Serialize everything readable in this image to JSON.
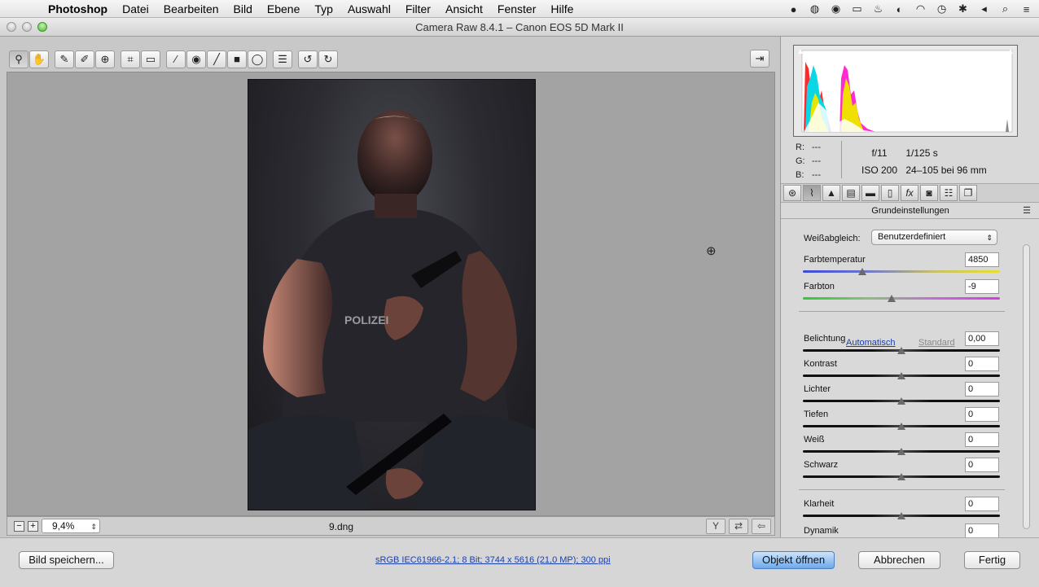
{
  "menubar": {
    "items": [
      "Photoshop",
      "Datei",
      "Bearbeiten",
      "Bild",
      "Ebene",
      "Typ",
      "Auswahl",
      "Filter",
      "Ansicht",
      "Fenster",
      "Hilfe"
    ]
  },
  "window": {
    "title": "Camera Raw 8.4.1 – Canon EOS 5D Mark II"
  },
  "toolbar": {
    "tools": [
      "zoom-icon",
      "hand-icon",
      "white-balance-icon",
      "color-sampler-icon",
      "target-adjust-icon",
      "crop-icon",
      "straighten-icon",
      "spot-removal-icon",
      "red-eye-icon",
      "adjustment-brush-icon",
      "graduated-filter-icon",
      "radial-filter-icon",
      "preferences-icon",
      "rotate-left-icon",
      "rotate-right-icon"
    ]
  },
  "status": {
    "zoom": "9,4%",
    "filename": "9.dng",
    "photo_caption": "POLIZEI"
  },
  "readout": {
    "r_label": "R:",
    "g_label": "G:",
    "b_label": "B:",
    "r_value": "---",
    "g_value": "---",
    "b_value": "---",
    "aperture": "f/11",
    "shutter": "1/125 s",
    "iso": "ISO 200",
    "lens": "24–105 bei 96 mm"
  },
  "panel": {
    "title": "Grundeinstellungen",
    "wb_label": "Weißabgleich:",
    "wb_value": "Benutzerdefiniert",
    "auto_label": "Automatisch",
    "default_label": "Standard",
    "sliders": [
      {
        "label": "Farbtemperatur",
        "value": "4850",
        "position": 0.3
      },
      {
        "label": "Farbton",
        "value": "-9",
        "position": 0.45
      },
      {
        "label": "Belichtung",
        "value": "0,00",
        "position": 0.5
      },
      {
        "label": "Kontrast",
        "value": "0",
        "position": 0.5
      },
      {
        "label": "Lichter",
        "value": "0",
        "position": 0.5
      },
      {
        "label": "Tiefen",
        "value": "0",
        "position": 0.5
      },
      {
        "label": "Weiß",
        "value": "0",
        "position": 0.5
      },
      {
        "label": "Schwarz",
        "value": "0",
        "position": 0.5
      },
      {
        "label": "Klarheit",
        "value": "0",
        "position": 0.5
      },
      {
        "label": "Dynamik",
        "value": "0",
        "position": 0.5
      }
    ]
  },
  "footer": {
    "save_label": "Bild speichern...",
    "file_info": "sRGB IEC61966-2.1; 8 Bit; 3744 x 5616 (21,0 MP); 300 ppi",
    "open_label": "Objekt öffnen",
    "cancel_label": "Abbrechen",
    "done_label": "Fertig"
  }
}
